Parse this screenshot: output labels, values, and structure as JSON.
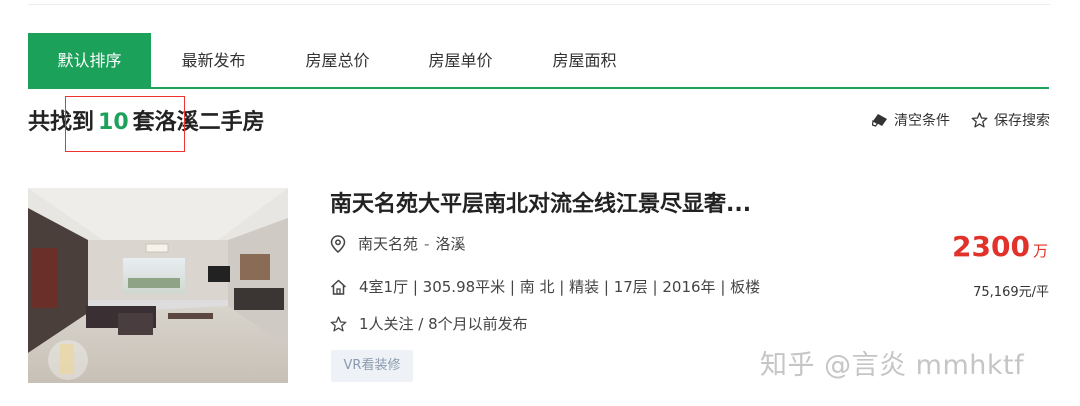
{
  "tabs": [
    "默认排序",
    "最新发布",
    "房屋总价",
    "房屋单价",
    "房屋面积"
  ],
  "result": {
    "prefix": "共找到",
    "count": "10",
    "suffix": "套洛溪二手房"
  },
  "actions": {
    "clear": "清空条件",
    "save": "保存搜索"
  },
  "listing": {
    "title": "南天名苑大平层南北对流全线江景尽显奢...",
    "community": "南天名苑",
    "area_sep": "-",
    "area": "洛溪",
    "info": "4室1厅 | 305.98平米 | 南 北 | 精装 | 17层 | 2016年 | 板楼",
    "follow": "1人关注 / 8个月以前发布",
    "tag": "VR看装修",
    "price": "2300",
    "price_unit": "万",
    "unit_price": "75,169元/平"
  },
  "watermark": "知乎 @言炎 mmhktf",
  "colors": {
    "accent": "#1ba159",
    "price": "#e0312a",
    "highlight_box": "#ee3333"
  }
}
